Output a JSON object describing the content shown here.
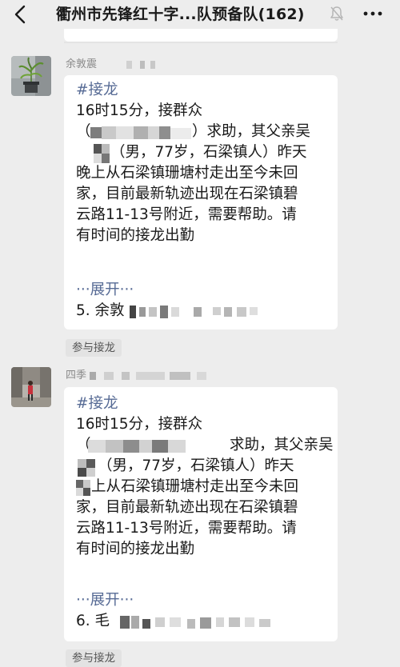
{
  "header": {
    "title": "衢州市先锋红十字...队预备队(162)"
  },
  "messages": [
    {
      "sender": "余敦震",
      "lines": [
        "#接龙",
        "16时15分，接群众",
        "（",
        "）求助，其父亲吴",
        "（男，77岁，石梁镇人）昨天",
        "晚上从石梁镇珊塘村走出至今未回",
        "家，目前最新轨迹出现在石梁镇碧",
        "云路11-13号附近，需要帮助。请",
        "有时间的接龙出勤"
      ],
      "expand": "···展开···",
      "entry": "5. 余敦",
      "join_label": "参与接龙"
    },
    {
      "sender": "四季",
      "lines": [
        "#接龙",
        "16时15分，接群众",
        "（",
        "求助，其父亲吴",
        "（男，77岁，石梁镇人）昨天",
        "上从石梁镇珊塘村走出至今未回",
        "家，目前最新轨迹出现在石梁镇碧",
        "云路11-13号附近，需要帮助。请",
        "有时间的接龙出勤"
      ],
      "expand": "···展开···",
      "entry": "6. 毛",
      "join_label": "参与接龙"
    }
  ]
}
